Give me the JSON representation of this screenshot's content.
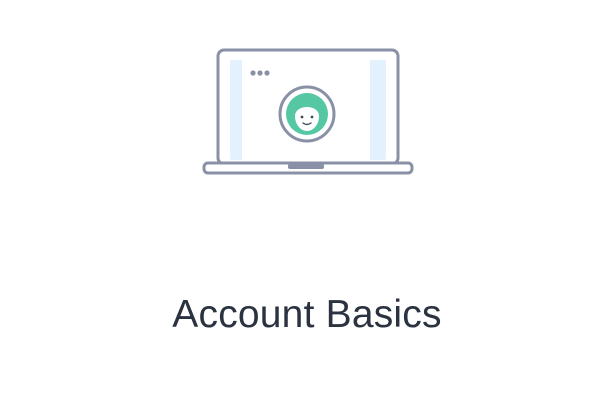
{
  "card": {
    "title": "Account Basics",
    "illustration_icon": "laptop-profile-icon"
  },
  "colors": {
    "outline": "#8a91a6",
    "screen_fill": "#e3f0fd",
    "avatar_green": "#55c7a3",
    "title_text": "#2b3240"
  }
}
